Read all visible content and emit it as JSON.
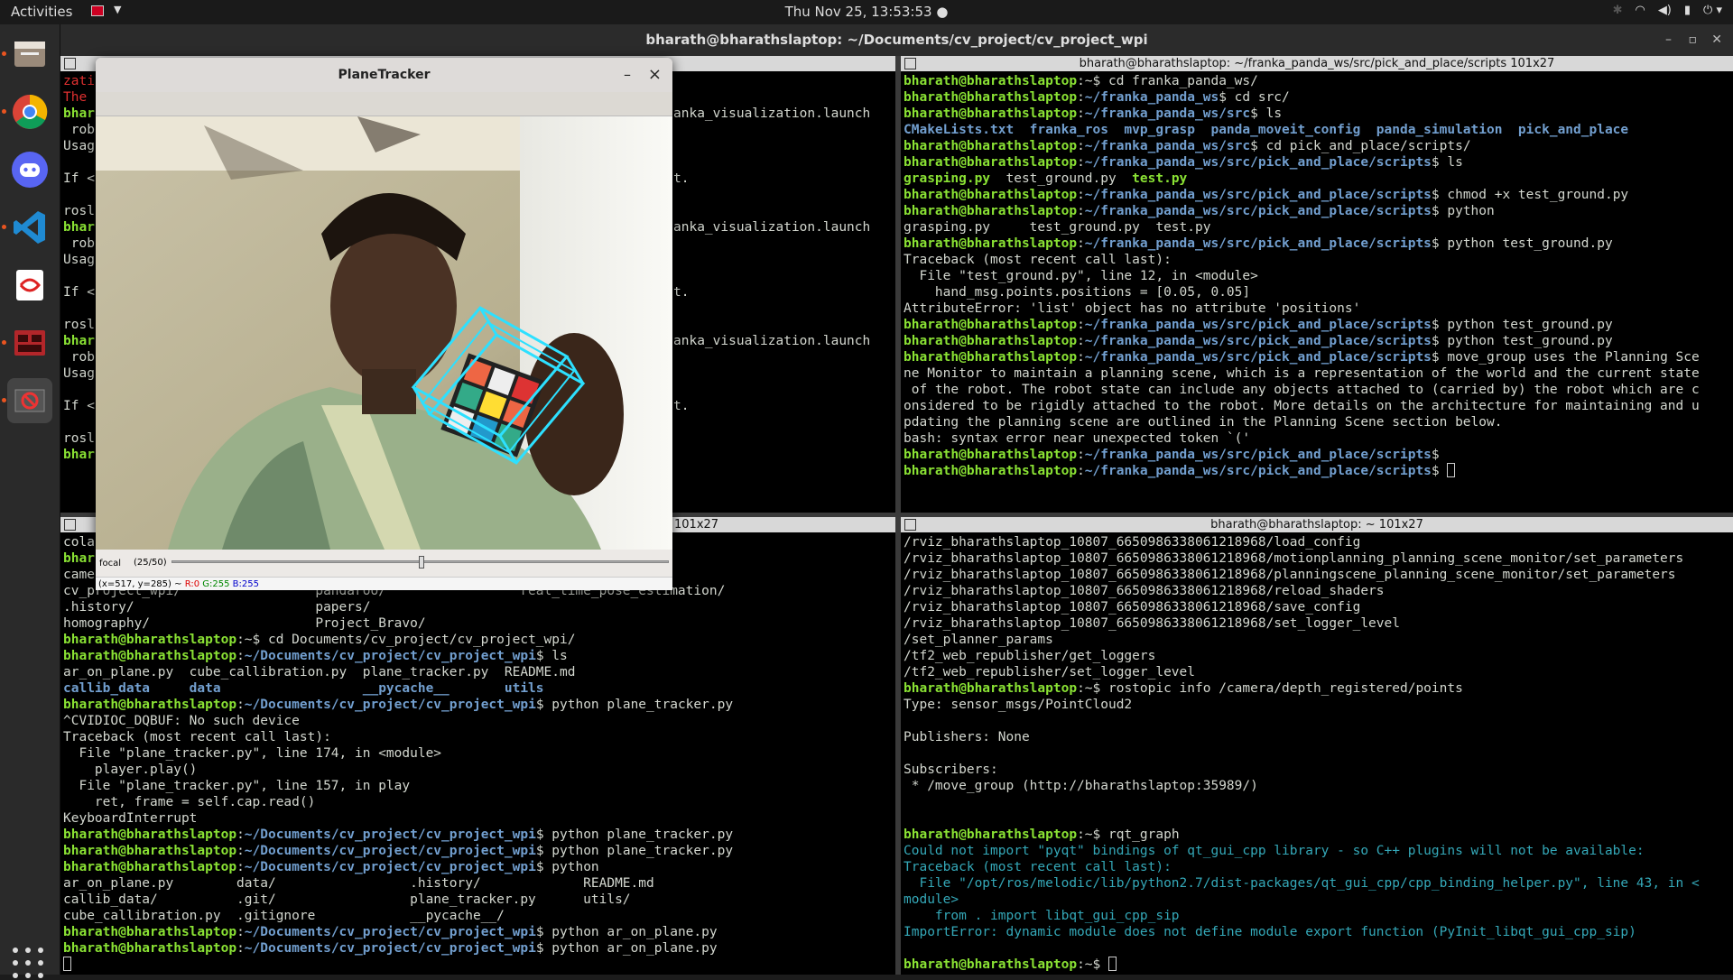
{
  "topbar": {
    "activities": "Activities",
    "clock": "Thu Nov 25, 13:53:53",
    "tray": [
      "wifi-icon",
      "volume-icon",
      "battery-icon",
      "power-icon"
    ]
  },
  "dock": {
    "items": [
      "files-icon",
      "chrome-icon",
      "discord-icon",
      "vscode-icon",
      "text-editor-icon",
      "terminal-icon",
      "planetracker-icon"
    ]
  },
  "terminal": {
    "title": "bharath@bharathslaptop: ~/Documents/cv_project/cv_project_wpi",
    "panes": {
      "tr": {
        "header": "bharath@bharathslaptop: ~/franka_panda_ws/src/pick_and_place/scripts 101x27"
      },
      "bl": {
        "header": "101x27"
      },
      "br": {
        "header": "bharath@bharathslaptop: ~ 101x27"
      }
    }
  },
  "planetracker": {
    "title": "PlaneTracker",
    "minimize": "–",
    "close": "×",
    "slider_label": "focal",
    "slider_value": "(25/50)",
    "slider_fraction": 0.5,
    "status": {
      "pos": "(x=517, y=285) ~",
      "r": "R:0",
      "g": "G:255",
      "b": "B:255"
    }
  },
  "left_top_lines": [
    {
      "t": "zati",
      "c": "r"
    },
    {
      "t": "The",
      "c": "r"
    },
    {
      "t": "bhar",
      "c": "g",
      "tail": "anka_visualization.launch"
    },
    {
      "t": " rob"
    },
    {
      "t": "Usag"
    },
    {
      "t": ""
    },
    {
      "t": "If <",
      "tail": "t."
    },
    {
      "t": ""
    },
    {
      "t": "rosl"
    },
    {
      "t": "bhar",
      "c": "g",
      "tail": "anka_visualization.launch"
    },
    {
      "t": " rob"
    },
    {
      "t": "Usag"
    },
    {
      "t": ""
    },
    {
      "t": "If <",
      "tail": "t."
    },
    {
      "t": ""
    },
    {
      "t": "rosl"
    },
    {
      "t": "bhar",
      "c": "g",
      "tail": "anka_visualization.launch"
    },
    {
      "t": " rob"
    },
    {
      "t": "Usag"
    },
    {
      "t": ""
    },
    {
      "t": "If <",
      "tail": "t."
    },
    {
      "t": ""
    },
    {
      "t": "rosl"
    },
    {
      "t": "bhar",
      "c": "g"
    }
  ],
  "tr_lines": [
    [
      [
        "bharath@bharathslaptop",
        "g"
      ],
      [
        ":~$ cd franka_panda_ws/",
        ""
      ]
    ],
    [
      [
        "bharath@bharathslaptop",
        "g"
      ],
      [
        ":",
        ""
      ],
      [
        "~/franka_panda_ws",
        "b"
      ],
      [
        "$ cd src/",
        ""
      ]
    ],
    [
      [
        "bharath@bharathslaptop",
        "g"
      ],
      [
        ":",
        ""
      ],
      [
        "~/franka_panda_ws/src",
        "b"
      ],
      [
        "$ ls",
        ""
      ]
    ],
    [
      [
        "CMakeLists.txt  franka_ros  mvp_grasp  panda_moveit_config  panda_simulation  pick_and_place",
        "b"
      ]
    ],
    [
      [
        "bharath@bharathslaptop",
        "g"
      ],
      [
        ":",
        ""
      ],
      [
        "~/franka_panda_ws/src",
        "b"
      ],
      [
        "$ cd pick_and_place/scripts/",
        ""
      ]
    ],
    [
      [
        "bharath@bharathslaptop",
        "g"
      ],
      [
        ":",
        ""
      ],
      [
        "~/franka_panda_ws/src/pick_and_place/scripts",
        "b"
      ],
      [
        "$ ls",
        ""
      ]
    ],
    [
      [
        "grasping.py",
        "g"
      ],
      [
        "  test_ground.py  ",
        ""
      ],
      [
        "test.py",
        "g"
      ]
    ],
    [
      [
        "bharath@bharathslaptop",
        "g"
      ],
      [
        ":",
        ""
      ],
      [
        "~/franka_panda_ws/src/pick_and_place/scripts",
        "b"
      ],
      [
        "$ chmod +x test_ground.py",
        ""
      ]
    ],
    [
      [
        "bharath@bharathslaptop",
        "g"
      ],
      [
        ":",
        ""
      ],
      [
        "~/franka_panda_ws/src/pick_and_place/scripts",
        "b"
      ],
      [
        "$ python",
        ""
      ]
    ],
    [
      [
        "grasping.py     test_ground.py  test.py",
        ""
      ]
    ],
    [
      [
        "bharath@bharathslaptop",
        "g"
      ],
      [
        ":",
        ""
      ],
      [
        "~/franka_panda_ws/src/pick_and_place/scripts",
        "b"
      ],
      [
        "$ python test_ground.py",
        ""
      ]
    ],
    [
      [
        "Traceback (most recent call last):",
        ""
      ]
    ],
    [
      [
        "  File \"test_ground.py\", line 12, in <module>",
        ""
      ]
    ],
    [
      [
        "    hand_msg.points.positions = [0.05, 0.05]",
        ""
      ]
    ],
    [
      [
        "AttributeError: 'list' object has no attribute 'positions'",
        ""
      ]
    ],
    [
      [
        "bharath@bharathslaptop",
        "g"
      ],
      [
        ":",
        ""
      ],
      [
        "~/franka_panda_ws/src/pick_and_place/scripts",
        "b"
      ],
      [
        "$ python test_ground.py",
        ""
      ]
    ],
    [
      [
        "bharath@bharathslaptop",
        "g"
      ],
      [
        ":",
        ""
      ],
      [
        "~/franka_panda_ws/src/pick_and_place/scripts",
        "b"
      ],
      [
        "$ python test_ground.py",
        ""
      ]
    ],
    [
      [
        "bharath@bharathslaptop",
        "g"
      ],
      [
        ":",
        ""
      ],
      [
        "~/franka_panda_ws/src/pick_and_place/scripts",
        "b"
      ],
      [
        "$ move_group uses the Planning Sce",
        ""
      ]
    ],
    [
      [
        "ne Monitor to maintain a planning scene, which is a representation of the world and the current state",
        ""
      ]
    ],
    [
      [
        " of the robot. The robot state can include any objects attached to (carried by) the robot which are c",
        ""
      ]
    ],
    [
      [
        "onsidered to be rigidly attached to the robot. More details on the architecture for maintaining and u",
        ""
      ]
    ],
    [
      [
        "pdating the planning scene are outlined in the Planning Scene section below.",
        ""
      ]
    ],
    [
      [
        "bash: syntax error near unexpected token `('",
        ""
      ]
    ],
    [
      [
        "bharath@bharathslaptop",
        "g"
      ],
      [
        ":",
        ""
      ],
      [
        "~/franka_panda_ws/src/pick_and_place/scripts",
        "b"
      ],
      [
        "$",
        ""
      ]
    ],
    [
      [
        "bharath@bharathslaptop",
        "g"
      ],
      [
        ":",
        ""
      ],
      [
        "~/franka_panda_ws/src/pick_and_place/scripts",
        "b"
      ],
      [
        "$ ",
        ""
      ],
      [
        "",
        "cur"
      ]
    ]
  ],
  "bl_lines": [
    [
      [
        "cola",
        ""
      ]
    ],
    [
      [
        "bhar",
        "g"
      ]
    ],
    [
      [
        "came",
        ""
      ]
    ],
    [
      [
        "cv_project_wpi/                 pandaroo/                 real_time_pose_estimation/",
        ""
      ]
    ],
    [
      [
        ".history/                       papers/",
        ""
      ]
    ],
    [
      [
        "homography/                     Project_Bravo/",
        ""
      ]
    ],
    [
      [
        "bharath@bharathslaptop",
        "g"
      ],
      [
        ":~$ cd Documents/cv_project/cv_project_wpi/",
        ""
      ]
    ],
    [
      [
        "bharath@bharathslaptop",
        "g"
      ],
      [
        ":",
        ""
      ],
      [
        "~/Documents/cv_project/cv_project_wpi",
        "b"
      ],
      [
        "$ ls",
        ""
      ]
    ],
    [
      [
        "ar_on_plane.py  cube_callibration.py  plane_tracker.py  README.md",
        ""
      ]
    ],
    [
      [
        "callib_data     data                  __pycache__       utils",
        "b"
      ]
    ],
    [
      [
        "bharath@bharathslaptop",
        "g"
      ],
      [
        ":",
        ""
      ],
      [
        "~/Documents/cv_project/cv_project_wpi",
        "b"
      ],
      [
        "$ python plane_tracker.py",
        ""
      ]
    ],
    [
      [
        "^CVIDIOC_DQBUF: No such device",
        ""
      ]
    ],
    [
      [
        "Traceback (most recent call last):",
        ""
      ]
    ],
    [
      [
        "  File \"plane_tracker.py\", line 174, in <module>",
        ""
      ]
    ],
    [
      [
        "    player.play()",
        ""
      ]
    ],
    [
      [
        "  File \"plane_tracker.py\", line 157, in play",
        ""
      ]
    ],
    [
      [
        "    ret, frame = self.cap.read()",
        ""
      ]
    ],
    [
      [
        "KeyboardInterrupt",
        ""
      ]
    ],
    [
      [
        "bharath@bharathslaptop",
        "g"
      ],
      [
        ":",
        ""
      ],
      [
        "~/Documents/cv_project/cv_project_wpi",
        "b"
      ],
      [
        "$ python plane_tracker.py",
        ""
      ]
    ],
    [
      [
        "bharath@bharathslaptop",
        "g"
      ],
      [
        ":",
        ""
      ],
      [
        "~/Documents/cv_project/cv_project_wpi",
        "b"
      ],
      [
        "$ python plane_tracker.py",
        ""
      ]
    ],
    [
      [
        "bharath@bharathslaptop",
        "g"
      ],
      [
        ":",
        ""
      ],
      [
        "~/Documents/cv_project/cv_project_wpi",
        "b"
      ],
      [
        "$ python",
        ""
      ]
    ],
    [
      [
        "ar_on_plane.py        data/                 .history/             README.md",
        ""
      ]
    ],
    [
      [
        "callib_data/          .git/                 plane_tracker.py      utils/",
        ""
      ]
    ],
    [
      [
        "cube_callibration.py  .gitignore            __pycache__/",
        ""
      ]
    ],
    [
      [
        "bharath@bharathslaptop",
        "g"
      ],
      [
        ":",
        ""
      ],
      [
        "~/Documents/cv_project/cv_project_wpi",
        "b"
      ],
      [
        "$ python ar_on_plane.py",
        ""
      ]
    ],
    [
      [
        "bharath@bharathslaptop",
        "g"
      ],
      [
        ":",
        ""
      ],
      [
        "~/Documents/cv_project/cv_project_wpi",
        "b"
      ],
      [
        "$ python ar_on_plane.py",
        ""
      ]
    ],
    [
      [
        "",
        "cur"
      ]
    ]
  ],
  "br_lines": [
    [
      [
        "/rviz_bharathslaptop_10807_6650986338061218968/load_config",
        ""
      ]
    ],
    [
      [
        "/rviz_bharathslaptop_10807_6650986338061218968/motionplanning_planning_scene_monitor/set_parameters",
        ""
      ]
    ],
    [
      [
        "/rviz_bharathslaptop_10807_6650986338061218968/planningscene_planning_scene_monitor/set_parameters",
        ""
      ]
    ],
    [
      [
        "/rviz_bharathslaptop_10807_6650986338061218968/reload_shaders",
        ""
      ]
    ],
    [
      [
        "/rviz_bharathslaptop_10807_6650986338061218968/save_config",
        ""
      ]
    ],
    [
      [
        "/rviz_bharathslaptop_10807_6650986338061218968/set_logger_level",
        ""
      ]
    ],
    [
      [
        "/set_planner_params",
        ""
      ]
    ],
    [
      [
        "/tf2_web_republisher/get_loggers",
        ""
      ]
    ],
    [
      [
        "/tf2_web_republisher/set_logger_level",
        ""
      ]
    ],
    [
      [
        "bharath@bharathslaptop",
        "g"
      ],
      [
        ":~$ rostopic info /camera/depth_registered/points",
        ""
      ]
    ],
    [
      [
        "Type: sensor_msgs/PointCloud2",
        ""
      ]
    ],
    [
      [
        "",
        ""
      ]
    ],
    [
      [
        "Publishers: None",
        ""
      ]
    ],
    [
      [
        "",
        ""
      ]
    ],
    [
      [
        "Subscribers:",
        ""
      ]
    ],
    [
      [
        " * /move_group (http://bharathslaptop:35989/)",
        ""
      ]
    ],
    [
      [
        "",
        ""
      ]
    ],
    [
      [
        "",
        ""
      ]
    ],
    [
      [
        "bharath@bharathslaptop",
        "g"
      ],
      [
        ":~$ rqt_graph",
        ""
      ]
    ],
    [
      [
        "Could not import \"pyqt\" bindings of qt_gui_cpp library - so C++ plugins will not be available:",
        "cy"
      ]
    ],
    [
      [
        "Traceback (most recent call last):",
        "cy"
      ]
    ],
    [
      [
        "  File \"/opt/ros/melodic/lib/python2.7/dist-packages/qt_gui_cpp/cpp_binding_helper.py\", line 43, in <",
        "cy"
      ]
    ],
    [
      [
        "module>",
        "cy"
      ]
    ],
    [
      [
        "    from . import libqt_gui_cpp_sip",
        "cy"
      ]
    ],
    [
      [
        "ImportError: dynamic module does not define module export function (PyInit_libqt_gui_cpp_sip)",
        "cy"
      ]
    ],
    [
      [
        "",
        ""
      ]
    ],
    [
      [
        "bharath@bharathslaptop",
        "g"
      ],
      [
        ":~$ ",
        ""
      ],
      [
        "",
        "cur"
      ]
    ]
  ]
}
